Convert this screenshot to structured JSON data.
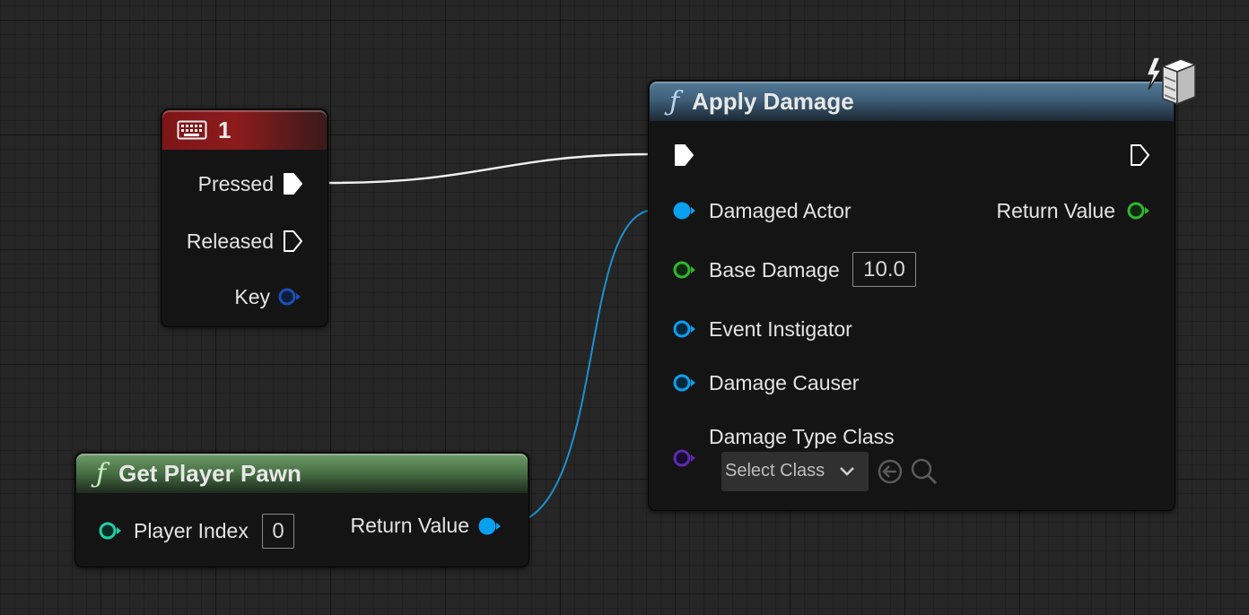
{
  "key_event_node": {
    "title": "1",
    "icon": "keyboard-icon",
    "header_color": "#8c1b1d",
    "pins": {
      "pressed": "Pressed",
      "released": "Released",
      "key": "Key"
    }
  },
  "apply_damage_node": {
    "title": "Apply Damage",
    "icon": "function-icon",
    "header_color": "#4a6d8a",
    "corner_icon": "server-lightning-icon",
    "pins": {
      "damaged_actor": "Damaged Actor",
      "return_value": "Return Value",
      "base_damage": "Base Damage",
      "base_damage_value": "10.0",
      "event_instigator": "Event Instigator",
      "damage_causer": "Damage Causer",
      "damage_type_class": "Damage Type Class",
      "select_class": "Select Class"
    },
    "select_icons": [
      "chevron-down-icon",
      "use-selected-arrow-icon",
      "browse-search-icon"
    ]
  },
  "get_player_pawn_node": {
    "title": "Get Player Pawn",
    "icon": "function-icon",
    "header_color": "#5a8756",
    "pins": {
      "player_index": "Player Index",
      "player_index_value": "0",
      "return_value": "Return Value"
    }
  },
  "pin_colors": {
    "exec": "#ffffff",
    "object": "#0aa0f0",
    "float": "#2fb82f",
    "struct_key": "#1d4fb5",
    "integer": "#1fd1a7",
    "class": "#5b2bad"
  },
  "wire_colors": {
    "exec": "#f2f2f2",
    "object": "#1c90d0"
  }
}
